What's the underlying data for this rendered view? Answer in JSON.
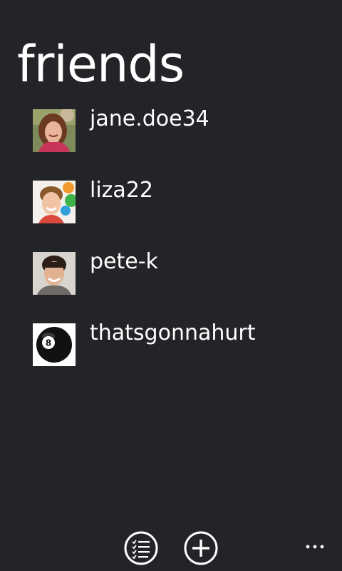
{
  "page": {
    "title": "friends"
  },
  "friends": [
    {
      "name": "jane.doe34",
      "avatar": "woman-smiling-portrait"
    },
    {
      "name": "liza22",
      "avatar": "girl-smiling-portrait"
    },
    {
      "name": "pete-k",
      "avatar": "man-smiling-portrait"
    },
    {
      "name": "thatsgonnahurt",
      "avatar": "eight-ball"
    }
  ],
  "app_bar": {
    "buttons": [
      {
        "icon": "list-check-icon"
      },
      {
        "icon": "add-icon"
      }
    ],
    "more_icon": "ellipsis-icon"
  },
  "colors": {
    "background": "#232427",
    "foreground": "#ffffff"
  }
}
